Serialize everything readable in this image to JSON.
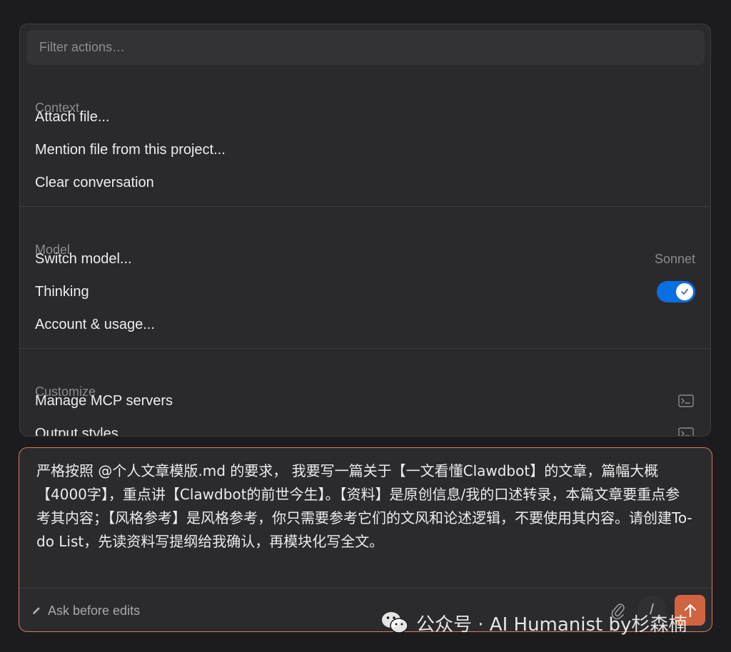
{
  "menu": {
    "filter_placeholder": "Filter actions…",
    "sections": {
      "context": {
        "label": "Context",
        "items": [
          "Attach file...",
          "Mention file from this project...",
          "Clear conversation"
        ]
      },
      "model": {
        "label": "Model",
        "switch_model": "Switch model...",
        "current_model": "Sonnet",
        "thinking": "Thinking",
        "thinking_enabled": true,
        "account": "Account & usage..."
      },
      "customize": {
        "label": "Customize",
        "items": [
          "Manage MCP servers",
          "Output styles"
        ]
      }
    }
  },
  "composer": {
    "prompt": "严格按照 @个人文章模版.md 的要求， 我要写一篇关于【一文看懂Clawdbot】的文章，篇幅大概【4000字】，重点讲【Clawdbot的前世今生】。【资料】是原创信息/我的口述转录，本篇文章要重点参考其内容；【风格参考】是风格参考，你只需要参考它们的文风和论述逻辑，不要使用其内容。请创建To-do List，先读资料写提纲给我确认，再模块化写全文。",
    "mode_label": "Ask before edits",
    "slash_label": "/"
  },
  "watermark": {
    "text": "公众号 · AI Humanist by杉森楠"
  },
  "colors": {
    "background": "#1c1c1e",
    "panel": "#2a2a2d",
    "accent": "#d16440",
    "toggle": "#0a6fe0",
    "composer_border": "#d9795a"
  },
  "icons": [
    "checkmark-icon",
    "terminal-icon",
    "pencil-icon",
    "paperclip-icon",
    "arrow-up-icon",
    "wechat-icon"
  ]
}
